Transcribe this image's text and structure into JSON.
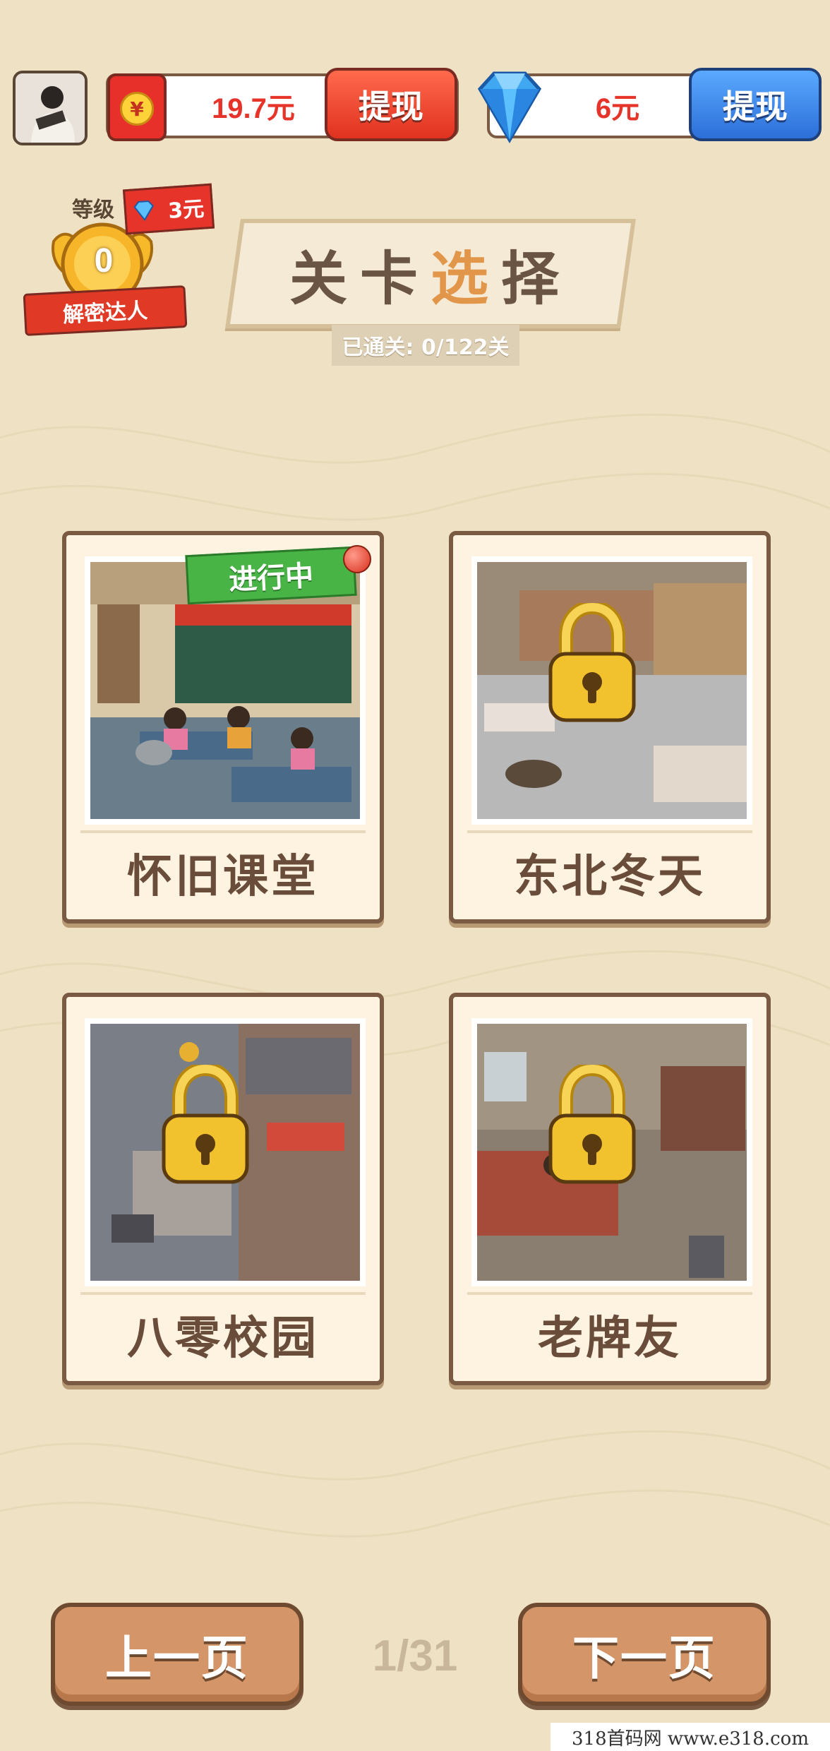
{
  "top_bar": {
    "cash_amount": "19.7元",
    "cash_withdraw_label": "提现",
    "diamond_amount": "6元",
    "diamond_withdraw_label": "提现"
  },
  "level_badge": {
    "label": "等级",
    "reward": "3元",
    "level": "0",
    "title": "解密达人"
  },
  "header": {
    "title_part1": "关卡",
    "title_accent": "选",
    "title_part2": "择",
    "progress": "已通关: 0/122关"
  },
  "levels": [
    {
      "name": "怀旧课堂",
      "status": "进行中",
      "locked": false
    },
    {
      "name": "东北冬天",
      "locked": true
    },
    {
      "name": "八零校园",
      "locked": true
    },
    {
      "name": "老牌友",
      "locked": true
    }
  ],
  "pager": {
    "prev_label": "上一页",
    "next_label": "下一页",
    "indicator": "1/31"
  },
  "watermark": "318首码网  www.e318.com",
  "colors": {
    "background": "#efe2c4",
    "card_border": "#7a5a42",
    "red_button": "#e0321f",
    "blue_button": "#2c6fd8",
    "in_progress_ribbon": "#49b446",
    "lock_gold": "#f2c12e"
  }
}
